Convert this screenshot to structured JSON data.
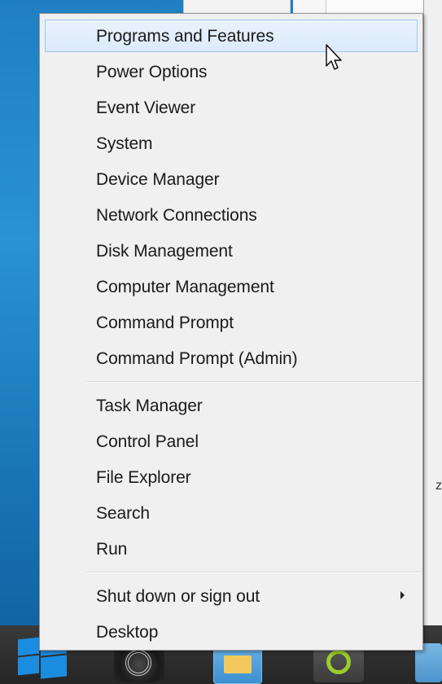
{
  "menu": {
    "group1": [
      {
        "label": "Programs and Features",
        "highlighted": true
      },
      {
        "label": "Power Options"
      },
      {
        "label": "Event Viewer"
      },
      {
        "label": "System"
      },
      {
        "label": "Device Manager"
      },
      {
        "label": "Network Connections"
      },
      {
        "label": "Disk Management"
      },
      {
        "label": "Computer Management"
      },
      {
        "label": "Command Prompt"
      },
      {
        "label": "Command Prompt (Admin)"
      }
    ],
    "group2": [
      {
        "label": "Task Manager"
      },
      {
        "label": "Control Panel"
      },
      {
        "label": "File Explorer"
      },
      {
        "label": "Search"
      },
      {
        "label": "Run"
      }
    ],
    "group3": [
      {
        "label": "Shut down or sign out",
        "has_submenu": true
      },
      {
        "label": "Desktop"
      }
    ]
  },
  "background": {
    "peek_char": "z"
  },
  "colors": {
    "highlight_bg": "#dbeafb",
    "highlight_border": "#9cc7ef",
    "menu_bg": "#f0f0f0",
    "taskbar_bg": "#2f2f2f",
    "desktop_bg": "#1f7fc2"
  },
  "icons": {
    "start_button": "windows-logo-icon",
    "taskbar_1": "audio-app-icon",
    "taskbar_2": "file-explorer-icon",
    "taskbar_3": "green-ring-app-icon",
    "taskbar_4": "partial-app-icon",
    "cursor": "mouse-pointer-icon"
  }
}
